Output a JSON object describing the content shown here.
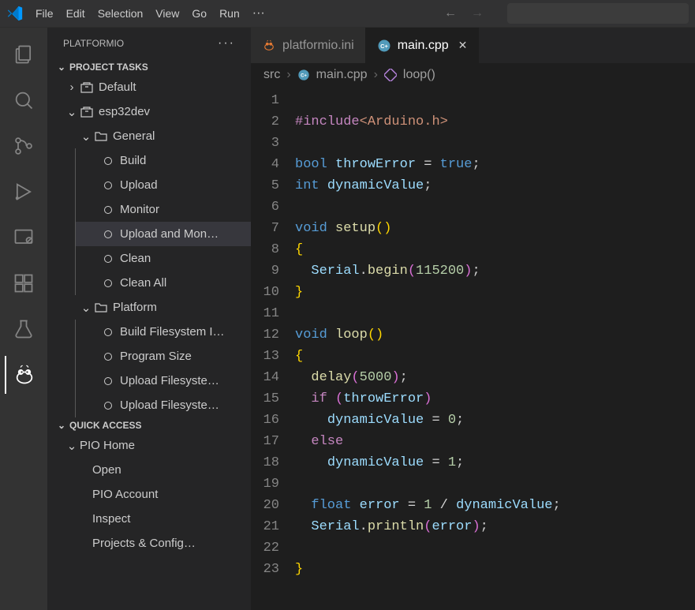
{
  "menubar": {
    "items": [
      "File",
      "Edit",
      "Selection",
      "View",
      "Go",
      "Run"
    ]
  },
  "sidebar": {
    "title": "PLATFORMIO",
    "section1": "PROJECT TASKS",
    "tree": {
      "default": "Default",
      "env": "esp32dev",
      "general": "General",
      "general_items": [
        "Build",
        "Upload",
        "Monitor",
        "Upload and Mon…",
        "Clean",
        "Clean All"
      ],
      "platform": "Platform",
      "platform_items": [
        "Build Filesystem I…",
        "Program Size",
        "Upload Filesyste…",
        "Upload Filesyste…"
      ]
    },
    "section2": "QUICK ACCESS",
    "pio_home": "PIO Home",
    "pio_items": [
      "Open",
      "PIO Account",
      "Inspect",
      "Projects & Config…"
    ]
  },
  "tabs": [
    {
      "label": "platformio.ini"
    },
    {
      "label": "main.cpp"
    }
  ],
  "breadcrumb": {
    "folder": "src",
    "file": "main.cpp",
    "symbol": "loop()"
  },
  "code": {
    "lines": 23
  }
}
